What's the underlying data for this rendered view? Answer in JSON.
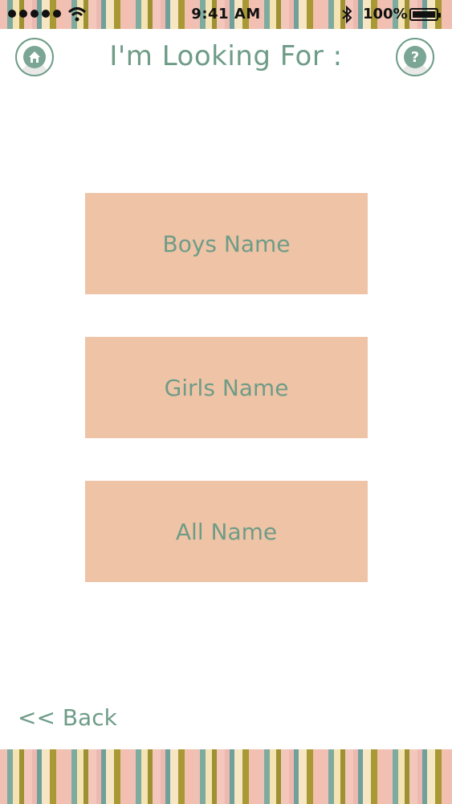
{
  "status_bar": {
    "time": "9:41 AM",
    "battery_text": "100%"
  },
  "header": {
    "title": "I'm Looking For :",
    "home_icon": "home-icon",
    "help_label": "?"
  },
  "choices": [
    {
      "label": "Boys Name"
    },
    {
      "label": "Girls Name"
    },
    {
      "label": "All Name"
    }
  ],
  "footer": {
    "back_label": "<< Back"
  },
  "colors": {
    "accent_green": "#6e9c87",
    "button_peach": "#efc3a6"
  }
}
